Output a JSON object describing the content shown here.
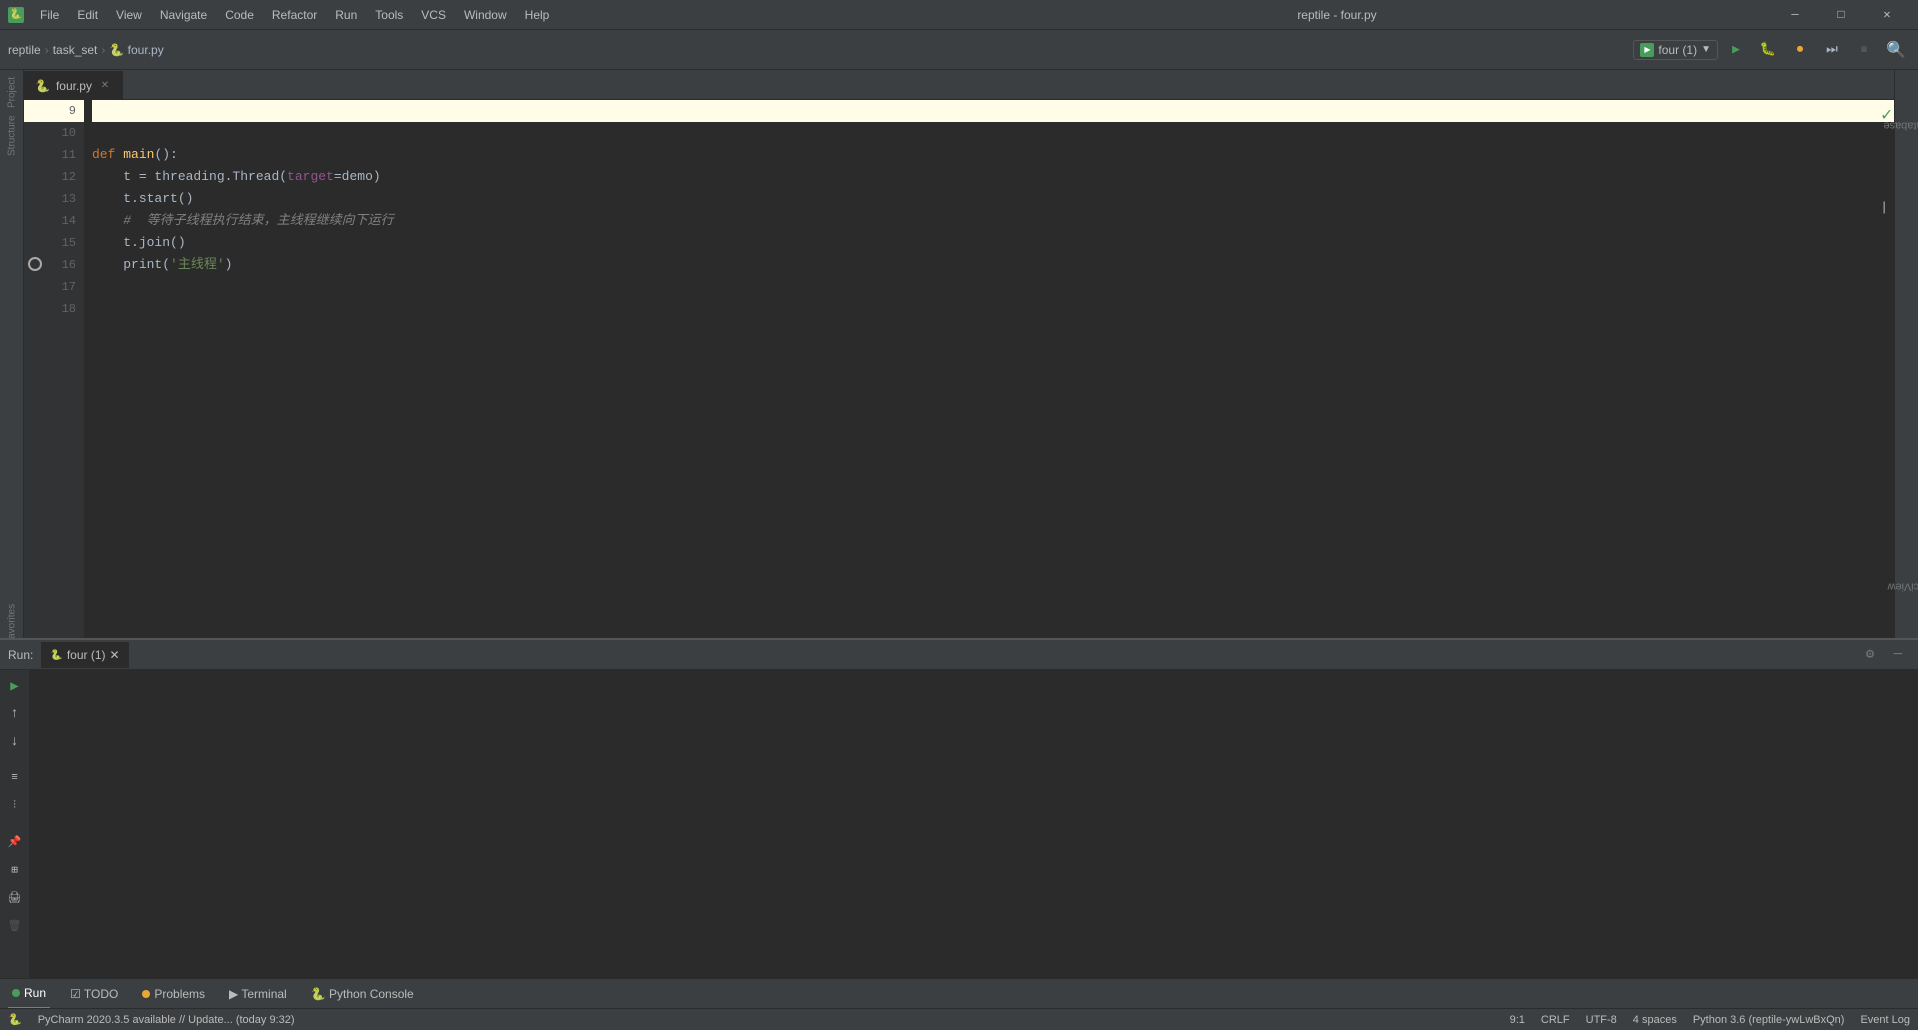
{
  "window": {
    "title": "reptile - four.py",
    "app_icon": "🐍"
  },
  "menu": {
    "items": [
      "File",
      "Edit",
      "View",
      "Navigate",
      "Code",
      "Refactor",
      "Run",
      "Tools",
      "VCS",
      "Window",
      "Help"
    ]
  },
  "toolbar": {
    "breadcrumb": [
      "reptile",
      "task_set",
      "four.py"
    ],
    "run_config": "four (1)",
    "run_label": "Run",
    "debug_label": "Debug",
    "coverage_label": "Coverage"
  },
  "editor": {
    "filename": "four.py",
    "lines": [
      {
        "num": 9,
        "content": "",
        "highlighted": true
      },
      {
        "num": 10,
        "content": ""
      },
      {
        "num": 11,
        "content": "def main():"
      },
      {
        "num": 12,
        "content": "    t = threading.Thread(target=demo)"
      },
      {
        "num": 13,
        "content": "    t.start()"
      },
      {
        "num": 14,
        "content": "    #  等待子线程执行结束，主线程继续向下运行"
      },
      {
        "num": 15,
        "content": "    t.join()"
      },
      {
        "num": 16,
        "content": "    print('主线程')"
      },
      {
        "num": 17,
        "content": ""
      },
      {
        "num": 18,
        "content": ""
      }
    ]
  },
  "run_panel": {
    "label": "Run:",
    "tab": "four (1)",
    "close_label": "×"
  },
  "bottom_tabs": [
    {
      "label": "Run",
      "icon": "run",
      "active": true
    },
    {
      "label": "TODO",
      "icon": "todo"
    },
    {
      "label": "Problems",
      "icon": "problems"
    },
    {
      "label": "Terminal",
      "icon": "terminal"
    },
    {
      "label": "Python Console",
      "icon": "python"
    }
  ],
  "status_bar": {
    "update_msg": "PyCharm 2020.3.5 available // Update... (today 9:32)",
    "position": "9:1",
    "line_ending": "CRLF",
    "encoding": "UTF-8",
    "indent": "4 spaces",
    "interpreter": "Python 3.6 (reptile-ywLwBxQn)",
    "event_log": "Event Log"
  },
  "right_panel": {
    "database_label": "Database",
    "sciview_label": "SciView"
  },
  "left_panel": {
    "project_label": "Project",
    "structure_label": "Structure",
    "favorites_label": "Favorites"
  }
}
